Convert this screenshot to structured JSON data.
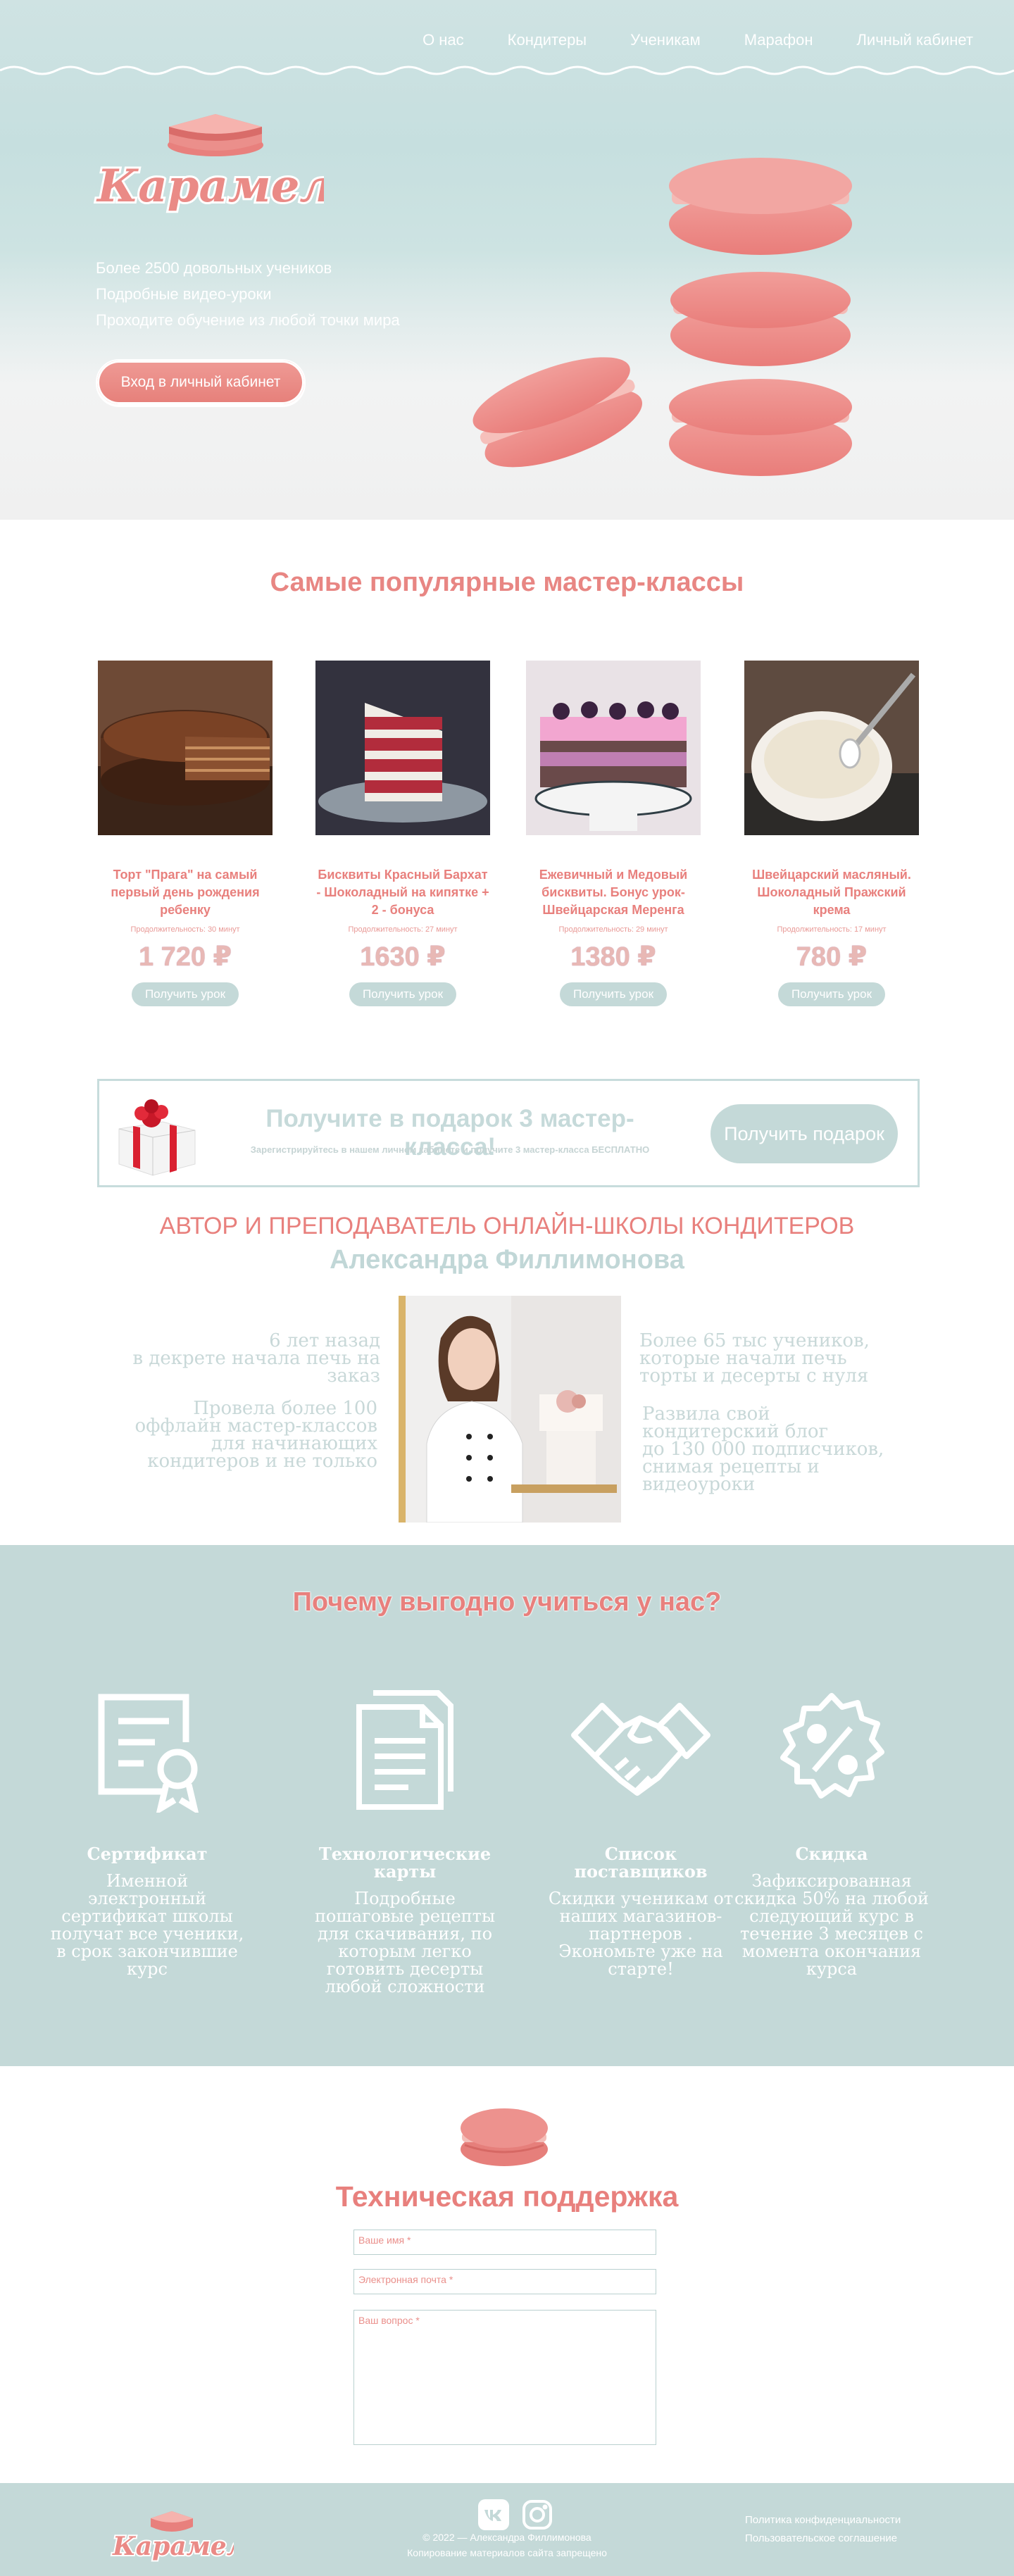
{
  "nav": {
    "items": [
      "О нас",
      "Кондитеры",
      "Ученикам",
      "Марафон",
      "Личный кабинет"
    ]
  },
  "brand": {
    "name": "Карамель"
  },
  "hero": {
    "features": [
      "Более 2500 довольных учеников",
      "Подробные видео-уроки",
      "Проходите обучение из любой точки мира"
    ],
    "cabinet_button": "Вход в личный кабинет"
  },
  "popular": {
    "title": "Самые популярные мастер-классы",
    "courses": [
      {
        "name": "Торт \"Прага\" на самый первый день рождения ребенку",
        "duration": "Продолжительность: 30 минут",
        "price": "1 720 ₽",
        "button": "Получить урок"
      },
      {
        "name": "Бисквиты Красный Бархат - Шоколадный на кипятке + 2 - бонуса",
        "duration": "Продолжительность: 27 минут",
        "price": "1630 ₽",
        "button": "Получить урок"
      },
      {
        "name": "Ежевичный и Медовый бисквиты. Бонус урок-Швейцарская Меренга",
        "duration": "Продолжительность: 29 минут",
        "price": "1380 ₽",
        "button": "Получить урок"
      },
      {
        "name": "Швейцарский масляный. Шоколадный Пражский крема",
        "duration": "Продолжительность: 17 минут",
        "price": "780 ₽",
        "button": "Получить урок"
      }
    ]
  },
  "gift": {
    "title": "Получите в подарок 3 мастер-класса!",
    "subtitle": "Зарегистрируйтесь в нашем личном кабинете и получите 3 мастер-класса БЕСПЛАТНО",
    "button": "Получить подарок"
  },
  "author": {
    "subtitle": "АВТОР И ПРЕПОДАВАТЕЛЬ ОНЛАЙН-ШКОЛЫ КОНДИТЕРОВ",
    "name": "Александра Филлимонова",
    "facts_left": [
      "6 лет назад\nв декрете начала печь на заказ",
      "Провела более 100 оффлайн мастер-классов для начинающих кондитеров и не только"
    ],
    "facts_right": [
      "Более 65 тыс учеников, которые начали печь торты и десерты с нуля",
      "Развила свой кондитерский блог\nдо 130 000 подписчиков, снимая рецепты и видеоуроки"
    ]
  },
  "benefits": {
    "title": "Почему выгодно учиться у нас?",
    "items": [
      {
        "icon": "certificate-icon",
        "title": "Сертификат",
        "text": "Именной электронный сертификат школы получат все ученики, в срок закончившие курс"
      },
      {
        "icon": "document-cards-icon",
        "title": "Технологические карты",
        "text": "Подробные пошаговые рецепты для скачивания, по которым легко готовить десерты любой сложности"
      },
      {
        "icon": "handshake-icon",
        "title": "Список поставщиков",
        "text": "Скидки ученикам от наших магазинов-партнеров . Экономьте уже на старте!"
      },
      {
        "icon": "discount-badge-icon",
        "title": "Скидка",
        "text": "Зафиксированная скидка 50% на любой следующий курс в течение 3 месяцев с момента окончания курса"
      }
    ]
  },
  "support": {
    "title": "Техническая поддержка",
    "name_placeholder": "Ваше имя *",
    "email_placeholder": "Электронная почта *",
    "question_placeholder": "Ваш вопрос *"
  },
  "footer": {
    "copyright": "© 2022 — Александра Филлимонова",
    "copy_notice": "Копирование материалов сайта запрещено",
    "links": [
      "Политика конфиденциальности",
      "Пользовательское соглашение"
    ],
    "socials": [
      "vk-icon",
      "instagram-icon"
    ]
  },
  "colors": {
    "accent": "#e8807d",
    "mint": "#c4d9d8",
    "white": "#ffffff"
  }
}
